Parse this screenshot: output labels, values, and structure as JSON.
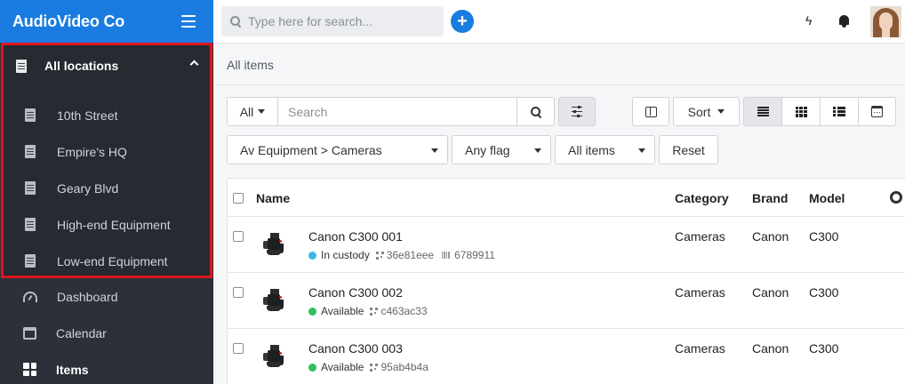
{
  "app": {
    "title": "AudioVideo Co"
  },
  "sidebar": {
    "locations_header": "All locations",
    "locations": [
      {
        "label": "10th Street"
      },
      {
        "label": "Empire's HQ"
      },
      {
        "label": "Geary Blvd"
      },
      {
        "label": "High-end Equipment"
      },
      {
        "label": "Low-end Equipment"
      }
    ],
    "nav": [
      {
        "label": "Dashboard",
        "icon": "dashboard-icon"
      },
      {
        "label": "Calendar",
        "icon": "calendar-icon"
      },
      {
        "label": "Items",
        "icon": "grid-icon",
        "active": true
      }
    ]
  },
  "topbar": {
    "search_placeholder": "Type here for search...",
    "add_label": "+"
  },
  "breadcrumb": "All items",
  "filters": {
    "scope": "All",
    "search_placeholder": "Search",
    "sort_label": "Sort",
    "category": "Av Equipment > Cameras",
    "flag": "Any flag",
    "items": "All items",
    "reset_label": "Reset"
  },
  "table": {
    "columns": [
      "Name",
      "Category",
      "Brand",
      "Model"
    ],
    "rows": [
      {
        "name": "Canon C300 001",
        "status": "In custody",
        "status_color": "#3bb7e8",
        "code": "36e81eee",
        "barcode": "6789911",
        "category": "Cameras",
        "brand": "Canon",
        "model": "C300"
      },
      {
        "name": "Canon C300 002",
        "status": "Available",
        "status_color": "#2ec05a",
        "code": "c463ac33",
        "category": "Cameras",
        "brand": "Canon",
        "model": "C300"
      },
      {
        "name": "Canon C300 003",
        "status": "Available",
        "status_color": "#2ec05a",
        "code": "95ab4b4a",
        "category": "Cameras",
        "brand": "Canon",
        "model": "C300"
      }
    ]
  },
  "colors": {
    "brand": "#1a7ce0",
    "sidebar": "#2c3038",
    "highlight": "#e0141e"
  }
}
